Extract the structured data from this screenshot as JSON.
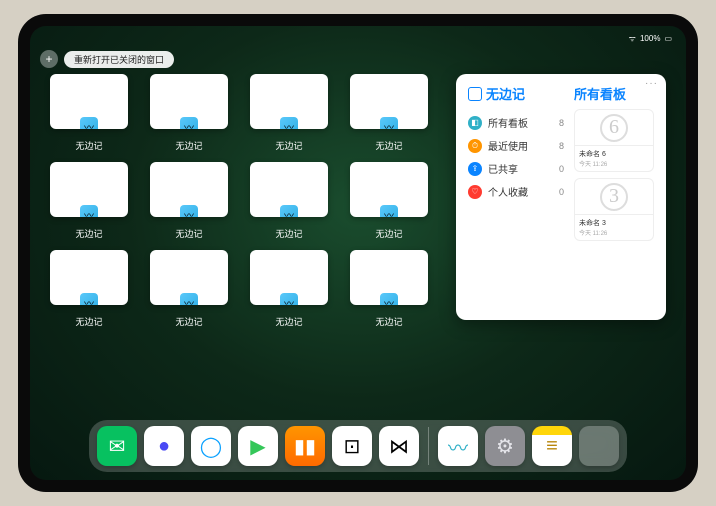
{
  "status": {
    "time": "",
    "battery": "100%",
    "wifi": "􀙇"
  },
  "top": {
    "plus": "+",
    "reopen": "重新打开已关闭的窗口"
  },
  "app_label": "无边记",
  "windows": [
    {
      "type": "blank"
    },
    {
      "type": "grid"
    },
    {
      "type": "grid"
    },
    {
      "type": "blank"
    },
    {
      "type": "grid"
    },
    {
      "type": "grid"
    },
    {
      "type": "blank"
    },
    {
      "type": "grid"
    },
    {
      "type": "grid"
    },
    {
      "type": "blank"
    },
    {
      "type": "grid"
    },
    {
      "type": "grid"
    }
  ],
  "panel": {
    "title": "无边记",
    "sidebar": [
      {
        "icon_color": "#30b0c7",
        "glyph": "◧",
        "label": "所有看板",
        "count": "8"
      },
      {
        "icon_color": "#ff9500",
        "glyph": "⏱",
        "label": "最近使用",
        "count": "8"
      },
      {
        "icon_color": "#0a84ff",
        "glyph": "⇪",
        "label": "已共享",
        "count": "0"
      },
      {
        "icon_color": "#ff3b30",
        "glyph": "♡",
        "label": "个人收藏",
        "count": "0"
      }
    ],
    "boards_title": "所有看板",
    "boards": [
      {
        "glyph": "6",
        "name": "未命名 6",
        "date": "今天 11:26"
      },
      {
        "glyph": "3",
        "name": "未命名 3",
        "date": "今天 11:26"
      }
    ],
    "more": "···"
  },
  "dock": [
    {
      "name": "wechat-icon",
      "bg": "#07c160",
      "glyph": "✉",
      "color": "#fff"
    },
    {
      "name": "quark-icon",
      "bg": "#fff",
      "glyph": "●",
      "color": "#4a4af4"
    },
    {
      "name": "qqbrowser-icon",
      "bg": "#fff",
      "glyph": "◯",
      "color": "#0aa1ff"
    },
    {
      "name": "play-icon",
      "bg": "#fff",
      "glyph": "▶",
      "color": "#34c759"
    },
    {
      "name": "books-icon",
      "bg": "linear-gradient(#ff9500,#ff6a00)",
      "glyph": "▮▮",
      "color": "#fff"
    },
    {
      "name": "dice-icon",
      "bg": "#fff",
      "glyph": "⊡",
      "color": "#000"
    },
    {
      "name": "connect-icon",
      "bg": "#fff",
      "glyph": "⋈",
      "color": "#000"
    }
  ],
  "dock_right": [
    {
      "name": "freeform-icon",
      "bg": "#fff",
      "glyph": "〰",
      "color": "#30b0c7"
    },
    {
      "name": "settings-icon",
      "bg": "#8e8e93",
      "glyph": "⚙",
      "color": "#e5e5ea"
    },
    {
      "name": "notes-icon",
      "bg": "linear-gradient(#ffd60a 22%, #fff 22%)",
      "glyph": "≡",
      "color": "#b8860b"
    }
  ]
}
